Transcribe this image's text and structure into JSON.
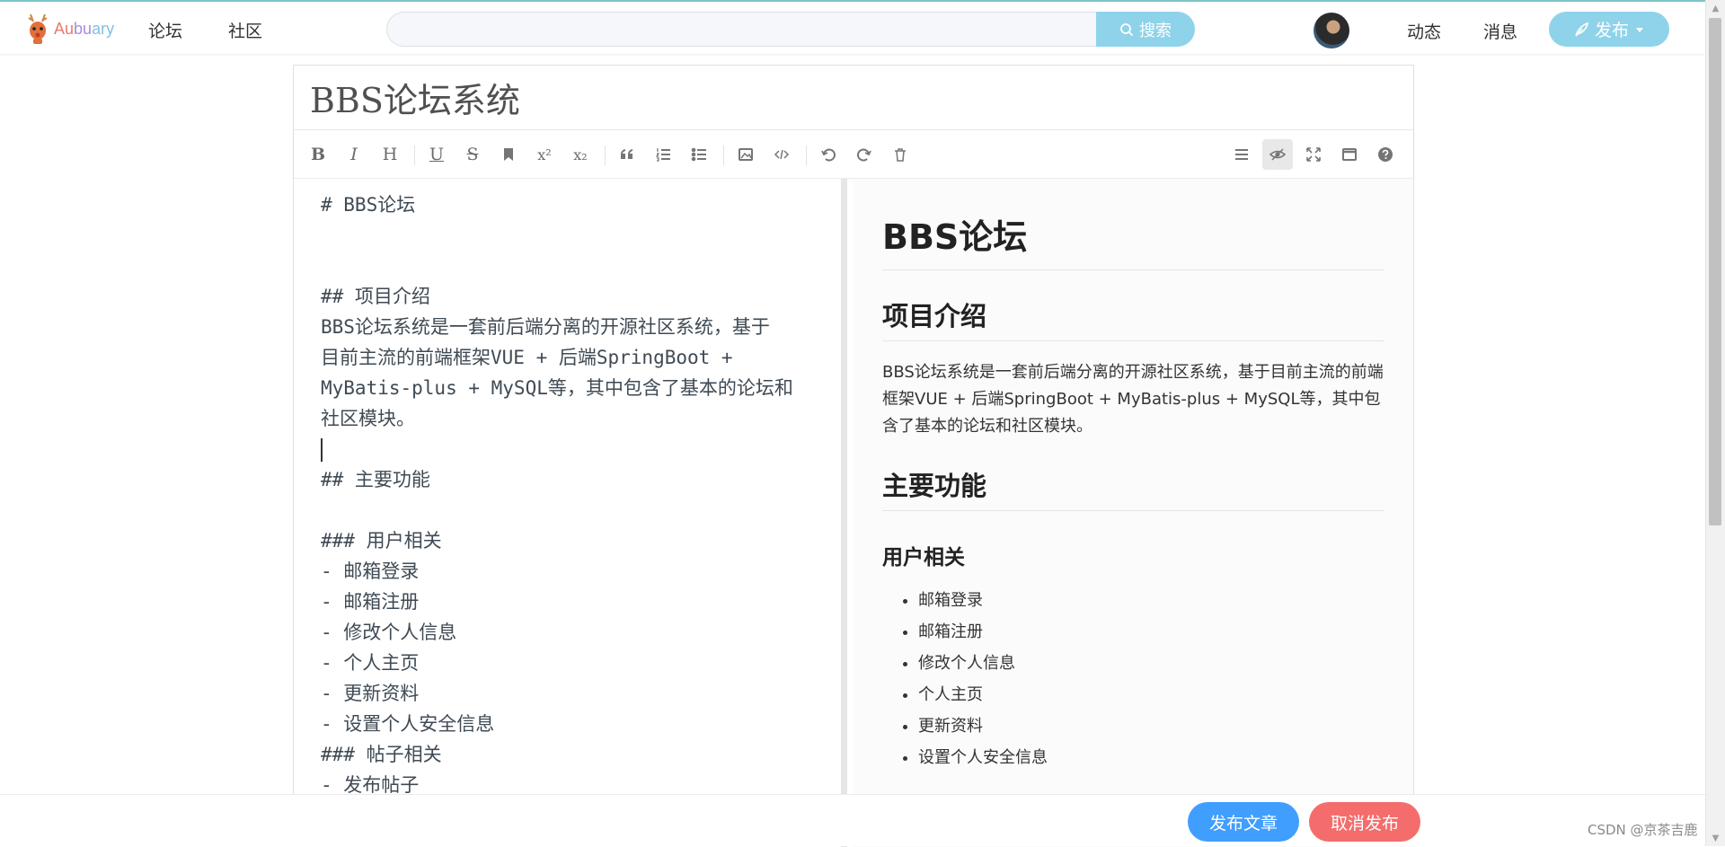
{
  "header": {
    "logo_text": [
      "Au",
      "bu",
      "ary"
    ],
    "nav": [
      "论坛",
      "社区"
    ],
    "search": {
      "placeholder": "",
      "button_label": "搜索"
    },
    "links": [
      "动态",
      "消息"
    ],
    "publish_label": "发布"
  },
  "editor": {
    "title": "BBS论坛系统",
    "markdown_lines": [
      "# BBS论坛",
      "",
      "",
      "## 项目介绍",
      "BBS论坛系统是一套前后端分离的开源社区系统，基于",
      "目前主流的前端框架VUE + 后端SpringBoot +",
      "MyBatis-plus + MySQL等，其中包含了基本的论坛和",
      "社区模块。",
      "",
      "## 主要功能",
      "",
      "### 用户相关",
      "- 邮箱登录",
      "- 邮箱注册",
      "- 修改个人信息",
      "- 个人主页",
      "- 更新资料",
      "- 设置个人安全信息",
      "### 帖子相关",
      "- 发布帖子"
    ],
    "preview": {
      "h1": "BBS论坛",
      "h2_intro": "项目介绍",
      "intro_paragraph": "BBS论坛系统是一套前后端分离的开源社区系统，基于目前主流的前端框架VUE + 后端SpringBoot + MyBatis-plus + MySQL等，其中包含了基本的论坛和社区模块。",
      "h2_features": "主要功能",
      "h3_user": "用户相关",
      "user_items": [
        "邮箱登录",
        "邮箱注册",
        "修改个人信息",
        "个人主页",
        "更新资料",
        "设置个人安全信息"
      ]
    }
  },
  "footer": {
    "publish_article": "发布文章",
    "cancel_publish": "取消发布",
    "watermark": "CSDN @京茶吉鹿"
  },
  "icons": {
    "logo": "deer-logo-icon",
    "search": "search-icon",
    "publish": "feather-icon",
    "dropdown": "caret-down-icon"
  },
  "colors": {
    "accent": "#8fd3ea",
    "primary": "#409eff",
    "danger": "#f56c6c"
  }
}
